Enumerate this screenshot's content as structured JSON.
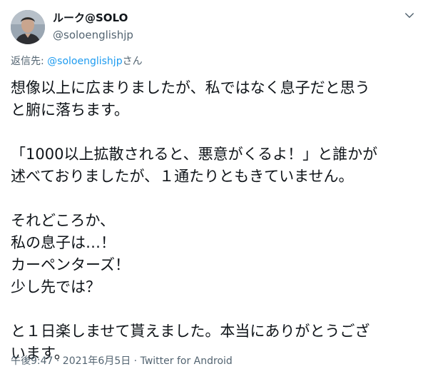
{
  "author": {
    "display_name": "ルーク@SOLO",
    "handle": "@soloenglishjp"
  },
  "reply": {
    "prefix": "返信先: ",
    "mention": "@soloenglishjp",
    "suffix": "さん"
  },
  "tweet": {
    "lines": [
      "想像以上に広まりましたが、私ではなく息子だと思う",
      "と腑に落ちます。",
      "「1000以上拡散されると、悪意がくるよ！」と誰かが",
      "述べておりましたが、１通たりともきていません。",
      "それどころか、",
      "私の息子は…！",
      "カーペンターズ！",
      "少し先では？",
      "と１日楽しませて貰えました。本当にありがとうござ",
      "います。"
    ]
  },
  "meta": {
    "timestamp": "午後9:47 · 2021年6月5日 · Twitter for Android"
  },
  "icons": {
    "caret": "chevron-down-icon",
    "avatar": "profile-photo"
  }
}
